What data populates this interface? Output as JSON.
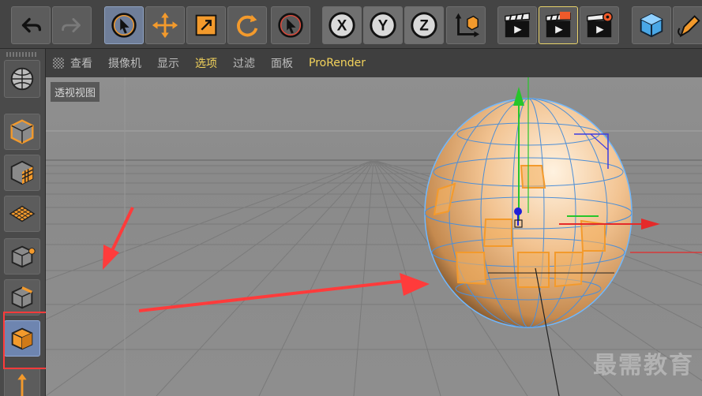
{
  "toolbar": {
    "groups": [
      {
        "name": "history",
        "buttons": [
          "undo-icon",
          "redo-icon"
        ]
      },
      {
        "name": "tools",
        "buttons": [
          "live-selection-icon",
          "move-icon",
          "scale-icon",
          "rotate-icon",
          "recent-tool-icon"
        ]
      },
      {
        "name": "axes",
        "buttons": [
          "x-axis-icon",
          "y-axis-icon",
          "z-axis-icon",
          "coordinate-system-icon"
        ]
      },
      {
        "name": "render",
        "buttons": [
          "render-view-icon",
          "render-picture-viewer-icon",
          "render-settings-icon"
        ]
      },
      {
        "name": "objects",
        "buttons": [
          "cube-object-icon",
          "pen-tool-icon"
        ]
      }
    ],
    "axis_labels": {
      "x": "X",
      "y": "Y",
      "z": "Z"
    }
  },
  "palette": {
    "buttons": [
      "make-editable-icon",
      "model-mode-icon",
      "texture-mode-icon",
      "workplane-mode-icon",
      "points-mode-icon",
      "edges-mode-icon",
      "polygons-mode-icon",
      "enable-axis-icon"
    ],
    "selected": "polygons-mode-icon"
  },
  "viewport_menu": {
    "items": [
      "查看",
      "摄像机",
      "显示",
      "选项",
      "过滤",
      "面板",
      "ProRender"
    ],
    "highlighted": [
      "选项",
      "ProRender"
    ]
  },
  "viewport": {
    "label": "透视视图",
    "watermark": "最需教育"
  },
  "colors": {
    "accent_orange": "#f39a2c",
    "selection_blue": "#6e85b0",
    "annotation_red": "#ff3b3b",
    "highlight_yellow": "#f3d35b"
  }
}
